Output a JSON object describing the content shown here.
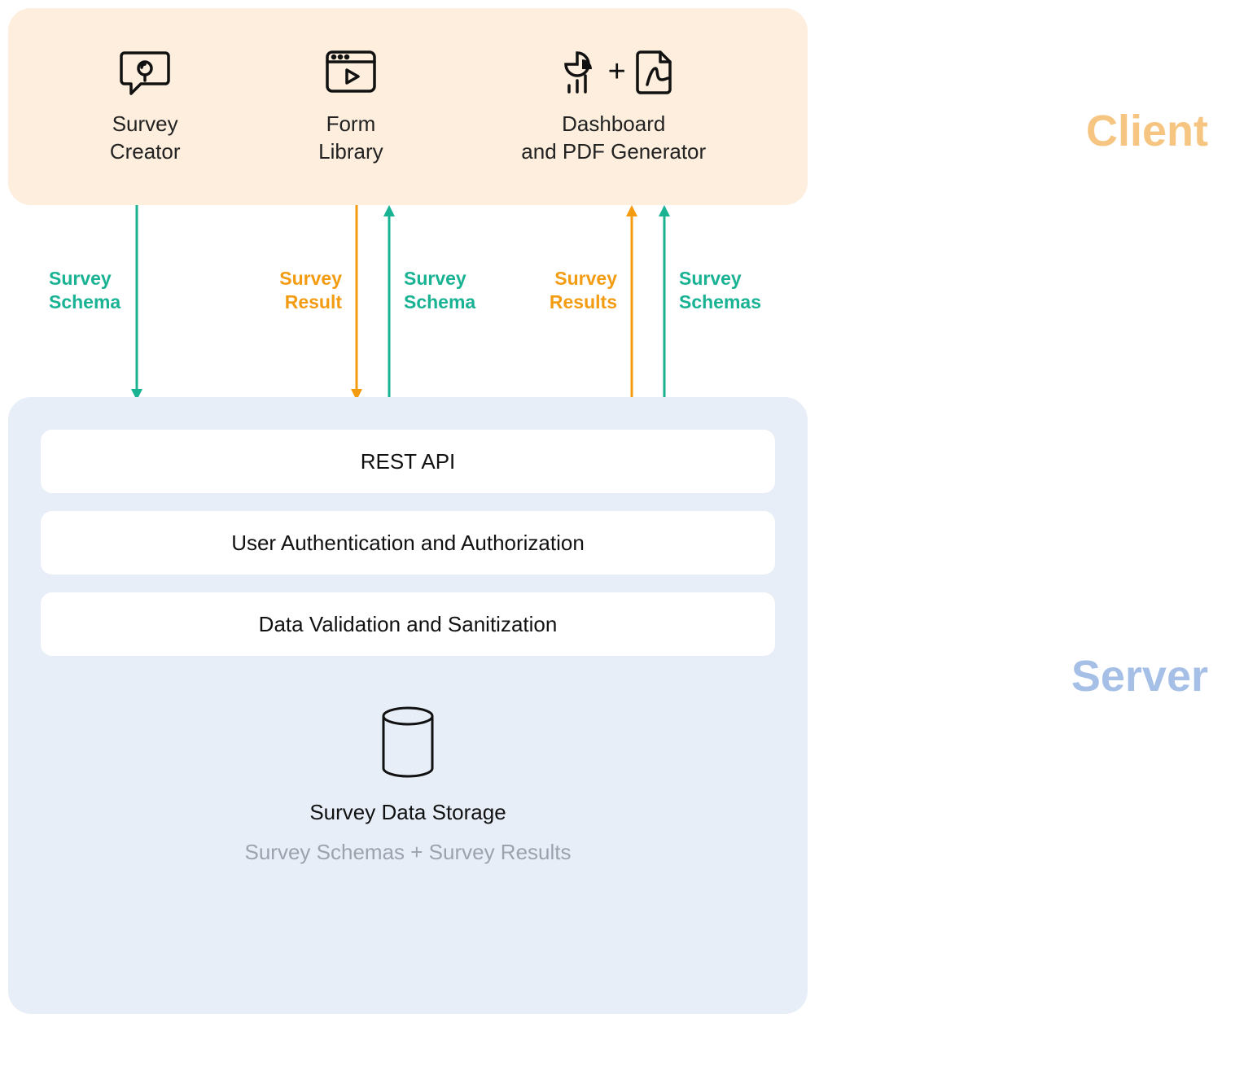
{
  "sections": {
    "client_label": "Client",
    "server_label": "Server"
  },
  "client": {
    "items": [
      {
        "label_line1": "Survey",
        "label_line2": "Creator"
      },
      {
        "label_line1": "Form",
        "label_line2": "Library"
      },
      {
        "label_line1": "Dashboard",
        "label_line2": "and PDF Generator",
        "plus": "+"
      }
    ]
  },
  "arrows": {
    "a1": {
      "label_line1": "Survey",
      "label_line2": "Schema",
      "color": "teal",
      "direction": "down"
    },
    "a2": {
      "label_line1": "Survey",
      "label_line2": "Result",
      "color": "orange",
      "direction": "down"
    },
    "a3": {
      "label_line1": "Survey",
      "label_line2": "Schema",
      "color": "teal",
      "direction": "up"
    },
    "a4": {
      "label_line1": "Survey",
      "label_line2": "Results",
      "color": "orange",
      "direction": "up"
    },
    "a5": {
      "label_line1": "Survey",
      "label_line2": "Schemas",
      "color": "teal",
      "direction": "up"
    }
  },
  "server": {
    "rows": [
      "REST API",
      "User Authentication and Authorization",
      "Data Validation and Sanitization"
    ],
    "storage": {
      "title": "Survey Data Storage",
      "subtitle": "Survey Schemas + Survey Results"
    }
  },
  "colors": {
    "teal": "#19B394",
    "orange": "#F39C12"
  }
}
